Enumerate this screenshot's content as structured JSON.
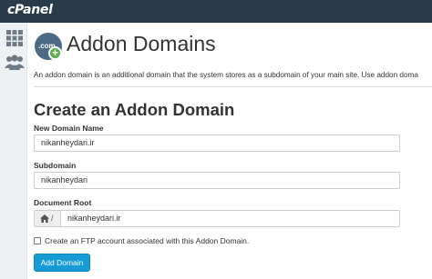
{
  "brand": {
    "logo_text": "cPanel"
  },
  "sidebar": {
    "items": [
      {
        "icon": "grid-icon"
      },
      {
        "icon": "users-icon"
      }
    ]
  },
  "header": {
    "page_icon_text": ".com",
    "title": "Addon Domains",
    "description": "An addon domain is an additional domain that the system stores as a subdomain of your main site. Use addon doma"
  },
  "form": {
    "section_title": "Create an Addon Domain",
    "new_domain": {
      "label": "New Domain Name",
      "value": "nikanheydari.ir"
    },
    "subdomain": {
      "label": "Subdomain",
      "value": "nikanheydari"
    },
    "document_root": {
      "label": "Document Root",
      "prefix": "/",
      "value": "nikanheydari.ir"
    },
    "ftp_checkbox": {
      "label": "Create an FTP account associated with this Addon Domain.",
      "checked": false
    },
    "submit_label": "Add Domain"
  },
  "colors": {
    "topbar": "#293a4a",
    "primary_button": "#179bd7",
    "sidebar_bg": "#eef1f3"
  }
}
